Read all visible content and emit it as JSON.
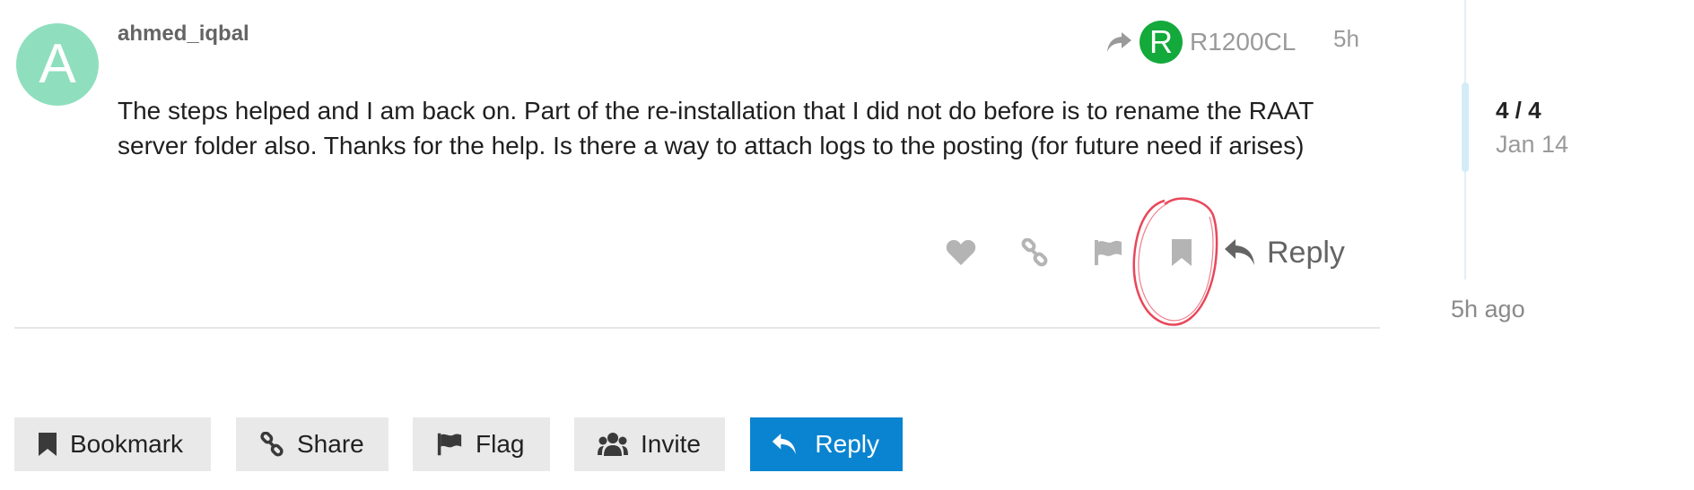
{
  "post": {
    "avatar_letter": "A",
    "avatar_color": "#8fdfbe",
    "username": "ahmed_iqbal",
    "reply_to": {
      "icon": "share-arrow-icon",
      "avatar_letter": "R",
      "avatar_color": "#13a93b",
      "username": "R1200CL"
    },
    "time": "5h",
    "body_lines": [
      "The steps helped and I am back on. Part of the re-installation that I did not do before is to rename the RAAT",
      "server folder also. Thanks for the help. Is there a way to attach logs to the posting (for future need if arises)"
    ],
    "actions": {
      "icons": [
        "heart-icon",
        "link-icon",
        "flag-icon",
        "bookmark-icon"
      ],
      "reply_label": "Reply"
    },
    "annotation": {
      "shape": "hand-drawn circle",
      "color": "#e8475a",
      "target": "bookmark-icon"
    }
  },
  "timeline": {
    "position": "4 / 4",
    "date": "Jan 14",
    "last_activity": "5h ago"
  },
  "footer_buttons": [
    {
      "icon": "bookmark-icon",
      "label": "Bookmark"
    },
    {
      "icon": "link-icon",
      "label": "Share"
    },
    {
      "icon": "flag-icon",
      "label": "Flag"
    },
    {
      "icon": "users-icon",
      "label": "Invite"
    },
    {
      "icon": "reply-icon",
      "label": "Reply",
      "accent": "#0a84d1"
    }
  ]
}
